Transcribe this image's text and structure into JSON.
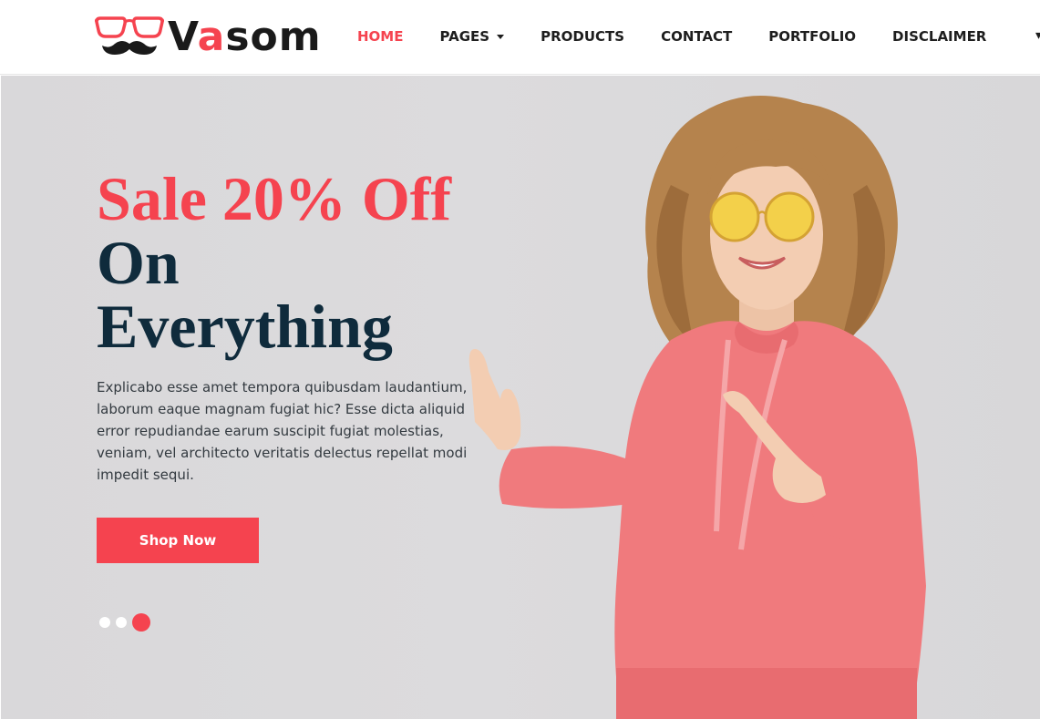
{
  "brand": {
    "name_prefix": "V",
    "name_accent": "a",
    "name_suffix": "som",
    "logo_icon": "glasses-mustache-icon",
    "accent_color": "#f5434f",
    "dark_color": "#0f2b3c"
  },
  "nav": {
    "items": [
      {
        "label": "HOME",
        "active": true
      },
      {
        "label": "PAGES",
        "has_dropdown": true
      },
      {
        "label": "PRODUCTS"
      },
      {
        "label": "CONTACT"
      },
      {
        "label": "PORTFOLIO"
      },
      {
        "label": "DISCLAIMER"
      }
    ],
    "overflow_glyph": "▾"
  },
  "hero": {
    "title_line1": "Sale 20% Off",
    "title_line2": "On",
    "title_line3": "Everything",
    "description": "Explicabo esse amet tempora quibusdam laudantium, laborum eaque magnam fugiat hic? Esse dicta aliquid error repudiandae earum suscipit fugiat molestias, veniam, vel architecto veritatis delectus repellat modi impedit sequi.",
    "cta_label": "Shop Now",
    "image": "woman-in-pink-hoodie-pointing",
    "slider": {
      "count": 3,
      "active_index": 3
    }
  }
}
